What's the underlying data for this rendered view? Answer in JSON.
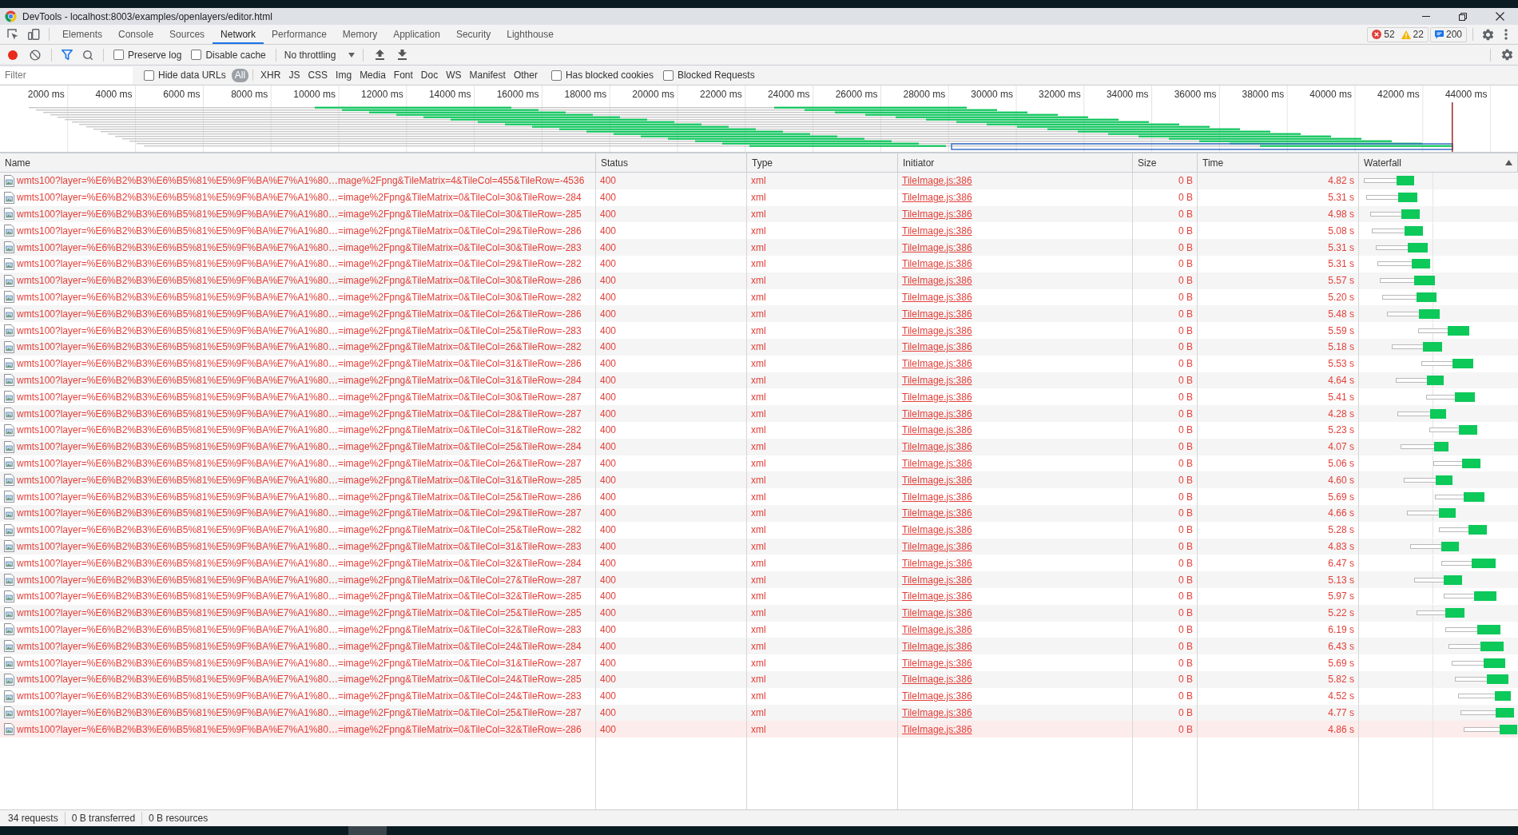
{
  "window": {
    "title": "DevTools - localhost:8003/examples/openlayers/editor.html"
  },
  "panel_tabs": [
    {
      "label": "Elements",
      "selected": false
    },
    {
      "label": "Console",
      "selected": false
    },
    {
      "label": "Sources",
      "selected": false
    },
    {
      "label": "Network",
      "selected": true
    },
    {
      "label": "Performance",
      "selected": false
    },
    {
      "label": "Memory",
      "selected": false
    },
    {
      "label": "Application",
      "selected": false
    },
    {
      "label": "Security",
      "selected": false
    },
    {
      "label": "Lighthouse",
      "selected": false
    }
  ],
  "console_counts": {
    "errors": "52",
    "warnings": "22",
    "messages": "200"
  },
  "network_toolbar": {
    "recording": true,
    "filter_active": true,
    "preserve_log": {
      "label": "Preserve log",
      "checked": false
    },
    "disable_cache": {
      "label": "Disable cache",
      "checked": false
    },
    "throttling": "No throttling"
  },
  "filter_bar": {
    "placeholder": "Filter",
    "hide_data_urls": {
      "label": "Hide data URLs",
      "checked": false
    },
    "types": [
      {
        "label": "All",
        "selected": true
      },
      {
        "label": "XHR",
        "selected": false
      },
      {
        "label": "JS",
        "selected": false
      },
      {
        "label": "CSS",
        "selected": false
      },
      {
        "label": "Img",
        "selected": false
      },
      {
        "label": "Media",
        "selected": false
      },
      {
        "label": "Font",
        "selected": false
      },
      {
        "label": "Doc",
        "selected": false
      },
      {
        "label": "WS",
        "selected": false
      },
      {
        "label": "Manifest",
        "selected": false
      },
      {
        "label": "Other",
        "selected": false
      }
    ],
    "blocked_cookies": {
      "label": "Has blocked cookies",
      "checked": false
    },
    "blocked_requests": {
      "label": "Blocked Requests",
      "checked": false
    }
  },
  "overview": {
    "ticks": [
      "2000 ms",
      "4000 ms",
      "6000 ms",
      "8000 ms",
      "10000 ms",
      "12000 ms",
      "14000 ms",
      "16000 ms",
      "18000 ms",
      "20000 ms",
      "22000 ms",
      "24000 ms",
      "26000 ms",
      "28000 ms",
      "30000 ms",
      "32000 ms",
      "34000 ms",
      "36000 ms",
      "38000 ms",
      "40000 ms",
      "42000 ms",
      "44000 ms"
    ]
  },
  "table": {
    "columns": [
      {
        "label": "Name",
        "sorted": false
      },
      {
        "label": "Status",
        "sorted": false
      },
      {
        "label": "Type",
        "sorted": false
      },
      {
        "label": "Initiator",
        "sorted": false
      },
      {
        "label": "Size",
        "sorted": false
      },
      {
        "label": "Time",
        "sorted": false
      },
      {
        "label": "Waterfall",
        "sorted": true
      }
    ],
    "rows": [
      {
        "name": "wmts100?layer=%E6%B2%B3%E6%B5%81%E5%9F%BA%E7%A1%80…mage%2Fpng&TileMatrix=4&TileCol=455&TileRow=-4536",
        "status": "400",
        "type": "xml",
        "initiator": "TileImage.js:386",
        "size": "0 B",
        "time": "4.82 s",
        "failed": true,
        "highlighted": false
      },
      {
        "name": "wmts100?layer=%E6%B2%B3%E6%B5%81%E5%9F%BA%E7%A1%80…=image%2Fpng&TileMatrix=0&TileCol=30&TileRow=-284",
        "status": "400",
        "type": "xml",
        "initiator": "TileImage.js:386",
        "size": "0 B",
        "time": "5.31 s",
        "failed": true,
        "highlighted": false
      },
      {
        "name": "wmts100?layer=%E6%B2%B3%E6%B5%81%E5%9F%BA%E7%A1%80…=image%2Fpng&TileMatrix=0&TileCol=30&TileRow=-285",
        "status": "400",
        "type": "xml",
        "initiator": "TileImage.js:386",
        "size": "0 B",
        "time": "4.98 s",
        "failed": true,
        "highlighted": false
      },
      {
        "name": "wmts100?layer=%E6%B2%B3%E6%B5%81%E5%9F%BA%E7%A1%80…=image%2Fpng&TileMatrix=0&TileCol=29&TileRow=-286",
        "status": "400",
        "type": "xml",
        "initiator": "TileImage.js:386",
        "size": "0 B",
        "time": "5.08 s",
        "failed": true,
        "highlighted": false
      },
      {
        "name": "wmts100?layer=%E6%B2%B3%E6%B5%81%E5%9F%BA%E7%A1%80…=image%2Fpng&TileMatrix=0&TileCol=30&TileRow=-283",
        "status": "400",
        "type": "xml",
        "initiator": "TileImage.js:386",
        "size": "0 B",
        "time": "5.31 s",
        "failed": true,
        "highlighted": false
      },
      {
        "name": "wmts100?layer=%E6%B2%B3%E6%B5%81%E5%9F%BA%E7%A1%80…=image%2Fpng&TileMatrix=0&TileCol=29&TileRow=-282",
        "status": "400",
        "type": "xml",
        "initiator": "TileImage.js:386",
        "size": "0 B",
        "time": "5.31 s",
        "failed": true,
        "highlighted": false
      },
      {
        "name": "wmts100?layer=%E6%B2%B3%E6%B5%81%E5%9F%BA%E7%A1%80…=image%2Fpng&TileMatrix=0&TileCol=30&TileRow=-286",
        "status": "400",
        "type": "xml",
        "initiator": "TileImage.js:386",
        "size": "0 B",
        "time": "5.57 s",
        "failed": true,
        "highlighted": false
      },
      {
        "name": "wmts100?layer=%E6%B2%B3%E6%B5%81%E5%9F%BA%E7%A1%80…=image%2Fpng&TileMatrix=0&TileCol=30&TileRow=-282",
        "status": "400",
        "type": "xml",
        "initiator": "TileImage.js:386",
        "size": "0 B",
        "time": "5.20 s",
        "failed": true,
        "highlighted": false
      },
      {
        "name": "wmts100?layer=%E6%B2%B3%E6%B5%81%E5%9F%BA%E7%A1%80…=image%2Fpng&TileMatrix=0&TileCol=26&TileRow=-286",
        "status": "400",
        "type": "xml",
        "initiator": "TileImage.js:386",
        "size": "0 B",
        "time": "5.48 s",
        "failed": true,
        "highlighted": false
      },
      {
        "name": "wmts100?layer=%E6%B2%B3%E6%B5%81%E5%9F%BA%E7%A1%80…=image%2Fpng&TileMatrix=0&TileCol=25&TileRow=-283",
        "status": "400",
        "type": "xml",
        "initiator": "TileImage.js:386",
        "size": "0 B",
        "time": "5.59 s",
        "failed": true,
        "highlighted": false
      },
      {
        "name": "wmts100?layer=%E6%B2%B3%E6%B5%81%E5%9F%BA%E7%A1%80…=image%2Fpng&TileMatrix=0&TileCol=26&TileRow=-282",
        "status": "400",
        "type": "xml",
        "initiator": "TileImage.js:386",
        "size": "0 B",
        "time": "5.18 s",
        "failed": true,
        "highlighted": false
      },
      {
        "name": "wmts100?layer=%E6%B2%B3%E6%B5%81%E5%9F%BA%E7%A1%80…=image%2Fpng&TileMatrix=0&TileCol=31&TileRow=-286",
        "status": "400",
        "type": "xml",
        "initiator": "TileImage.js:386",
        "size": "0 B",
        "time": "5.53 s",
        "failed": true,
        "highlighted": false
      },
      {
        "name": "wmts100?layer=%E6%B2%B3%E6%B5%81%E5%9F%BA%E7%A1%80…=image%2Fpng&TileMatrix=0&TileCol=31&TileRow=-284",
        "status": "400",
        "type": "xml",
        "initiator": "TileImage.js:386",
        "size": "0 B",
        "time": "4.64 s",
        "failed": true,
        "highlighted": false
      },
      {
        "name": "wmts100?layer=%E6%B2%B3%E6%B5%81%E5%9F%BA%E7%A1%80…=image%2Fpng&TileMatrix=0&TileCol=30&TileRow=-287",
        "status": "400",
        "type": "xml",
        "initiator": "TileImage.js:386",
        "size": "0 B",
        "time": "5.41 s",
        "failed": true,
        "highlighted": false
      },
      {
        "name": "wmts100?layer=%E6%B2%B3%E6%B5%81%E5%9F%BA%E7%A1%80…=image%2Fpng&TileMatrix=0&TileCol=28&TileRow=-287",
        "status": "400",
        "type": "xml",
        "initiator": "TileImage.js:386",
        "size": "0 B",
        "time": "4.28 s",
        "failed": true,
        "highlighted": false
      },
      {
        "name": "wmts100?layer=%E6%B2%B3%E6%B5%81%E5%9F%BA%E7%A1%80…=image%2Fpng&TileMatrix=0&TileCol=31&TileRow=-282",
        "status": "400",
        "type": "xml",
        "initiator": "TileImage.js:386",
        "size": "0 B",
        "time": "5.23 s",
        "failed": true,
        "highlighted": false
      },
      {
        "name": "wmts100?layer=%E6%B2%B3%E6%B5%81%E5%9F%BA%E7%A1%80…=image%2Fpng&TileMatrix=0&TileCol=25&TileRow=-284",
        "status": "400",
        "type": "xml",
        "initiator": "TileImage.js:386",
        "size": "0 B",
        "time": "4.07 s",
        "failed": true,
        "highlighted": false
      },
      {
        "name": "wmts100?layer=%E6%B2%B3%E6%B5%81%E5%9F%BA%E7%A1%80…=image%2Fpng&TileMatrix=0&TileCol=26&TileRow=-287",
        "status": "400",
        "type": "xml",
        "initiator": "TileImage.js:386",
        "size": "0 B",
        "time": "5.06 s",
        "failed": true,
        "highlighted": false
      },
      {
        "name": "wmts100?layer=%E6%B2%B3%E6%B5%81%E5%9F%BA%E7%A1%80…=image%2Fpng&TileMatrix=0&TileCol=31&TileRow=-285",
        "status": "400",
        "type": "xml",
        "initiator": "TileImage.js:386",
        "size": "0 B",
        "time": "4.60 s",
        "failed": true,
        "highlighted": false
      },
      {
        "name": "wmts100?layer=%E6%B2%B3%E6%B5%81%E5%9F%BA%E7%A1%80…=image%2Fpng&TileMatrix=0&TileCol=25&TileRow=-286",
        "status": "400",
        "type": "xml",
        "initiator": "TileImage.js:386",
        "size": "0 B",
        "time": "5.69 s",
        "failed": true,
        "highlighted": false
      },
      {
        "name": "wmts100?layer=%E6%B2%B3%E6%B5%81%E5%9F%BA%E7%A1%80…=image%2Fpng&TileMatrix=0&TileCol=29&TileRow=-287",
        "status": "400",
        "type": "xml",
        "initiator": "TileImage.js:386",
        "size": "0 B",
        "time": "4.66 s",
        "failed": true,
        "highlighted": false
      },
      {
        "name": "wmts100?layer=%E6%B2%B3%E6%B5%81%E5%9F%BA%E7%A1%80…=image%2Fpng&TileMatrix=0&TileCol=25&TileRow=-282",
        "status": "400",
        "type": "xml",
        "initiator": "TileImage.js:386",
        "size": "0 B",
        "time": "5.28 s",
        "failed": true,
        "highlighted": false
      },
      {
        "name": "wmts100?layer=%E6%B2%B3%E6%B5%81%E5%9F%BA%E7%A1%80…=image%2Fpng&TileMatrix=0&TileCol=31&TileRow=-283",
        "status": "400",
        "type": "xml",
        "initiator": "TileImage.js:386",
        "size": "0 B",
        "time": "4.83 s",
        "failed": true,
        "highlighted": false
      },
      {
        "name": "wmts100?layer=%E6%B2%B3%E6%B5%81%E5%9F%BA%E7%A1%80…=image%2Fpng&TileMatrix=0&TileCol=32&TileRow=-284",
        "status": "400",
        "type": "xml",
        "initiator": "TileImage.js:386",
        "size": "0 B",
        "time": "6.47 s",
        "failed": true,
        "highlighted": false
      },
      {
        "name": "wmts100?layer=%E6%B2%B3%E6%B5%81%E5%9F%BA%E7%A1%80…=image%2Fpng&TileMatrix=0&TileCol=27&TileRow=-287",
        "status": "400",
        "type": "xml",
        "initiator": "TileImage.js:386",
        "size": "0 B",
        "time": "5.13 s",
        "failed": true,
        "highlighted": false
      },
      {
        "name": "wmts100?layer=%E6%B2%B3%E6%B5%81%E5%9F%BA%E7%A1%80…=image%2Fpng&TileMatrix=0&TileCol=32&TileRow=-285",
        "status": "400",
        "type": "xml",
        "initiator": "TileImage.js:386",
        "size": "0 B",
        "time": "5.97 s",
        "failed": true,
        "highlighted": false
      },
      {
        "name": "wmts100?layer=%E6%B2%B3%E6%B5%81%E5%9F%BA%E7%A1%80…=image%2Fpng&TileMatrix=0&TileCol=25&TileRow=-285",
        "status": "400",
        "type": "xml",
        "initiator": "TileImage.js:386",
        "size": "0 B",
        "time": "5.22 s",
        "failed": true,
        "highlighted": false
      },
      {
        "name": "wmts100?layer=%E6%B2%B3%E6%B5%81%E5%9F%BA%E7%A1%80…=image%2Fpng&TileMatrix=0&TileCol=32&TileRow=-283",
        "status": "400",
        "type": "xml",
        "initiator": "TileImage.js:386",
        "size": "0 B",
        "time": "6.19 s",
        "failed": true,
        "highlighted": false
      },
      {
        "name": "wmts100?layer=%E6%B2%B3%E6%B5%81%E5%9F%BA%E7%A1%80…=image%2Fpng&TileMatrix=0&TileCol=24&TileRow=-284",
        "status": "400",
        "type": "xml",
        "initiator": "TileImage.js:386",
        "size": "0 B",
        "time": "6.43 s",
        "failed": true,
        "highlighted": false
      },
      {
        "name": "wmts100?layer=%E6%B2%B3%E6%B5%81%E5%9F%BA%E7%A1%80…=image%2Fpng&TileMatrix=0&TileCol=31&TileRow=-287",
        "status": "400",
        "type": "xml",
        "initiator": "TileImage.js:386",
        "size": "0 B",
        "time": "5.69 s",
        "failed": true,
        "highlighted": false
      },
      {
        "name": "wmts100?layer=%E6%B2%B3%E6%B5%81%E5%9F%BA%E7%A1%80…=image%2Fpng&TileMatrix=0&TileCol=24&TileRow=-285",
        "status": "400",
        "type": "xml",
        "initiator": "TileImage.js:386",
        "size": "0 B",
        "time": "5.82 s",
        "failed": true,
        "highlighted": false
      },
      {
        "name": "wmts100?layer=%E6%B2%B3%E6%B5%81%E5%9F%BA%E7%A1%80…=image%2Fpng&TileMatrix=0&TileCol=24&TileRow=-283",
        "status": "400",
        "type": "xml",
        "initiator": "TileImage.js:386",
        "size": "0 B",
        "time": "4.52 s",
        "failed": true,
        "highlighted": false
      },
      {
        "name": "wmts100?layer=%E6%B2%B3%E6%B5%81%E5%9F%BA%E7%A1%80…=image%2Fpng&TileMatrix=0&TileCol=25&TileRow=-287",
        "status": "400",
        "type": "xml",
        "initiator": "TileImage.js:386",
        "size": "0 B",
        "time": "4.77 s",
        "failed": true,
        "highlighted": false
      },
      {
        "name": "wmts100?layer=%E6%B2%B3%E6%B5%81%E5%9F%BA%E7%A1%80…=image%2Fpng&TileMatrix=0&TileCol=32&TileRow=-286",
        "status": "400",
        "type": "xml",
        "initiator": "TileImage.js:386",
        "size": "0 B",
        "time": "4.86 s",
        "failed": true,
        "highlighted": true
      }
    ]
  },
  "status_bar": [
    "34 requests",
    "0 B transferred",
    "0 B resources"
  ]
}
